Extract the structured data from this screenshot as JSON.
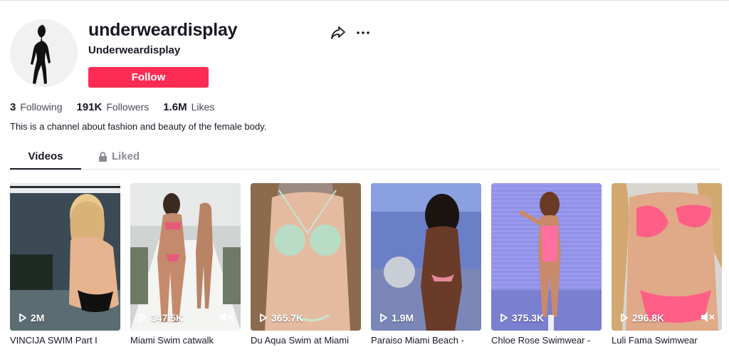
{
  "profile": {
    "username": "underweardisplay",
    "nickname": "Underweardisplay",
    "follow_label": "Follow",
    "bio": "This is a channel about fashion and beauty of the female body."
  },
  "stats": {
    "following_count": "3",
    "following_label": "Following",
    "followers_count": "191K",
    "followers_label": "Followers",
    "likes_count": "1.6M",
    "likes_label": "Likes"
  },
  "tabs": {
    "videos": "Videos",
    "liked": "Liked"
  },
  "icons": {
    "share": "share-icon",
    "more": "more-icon",
    "lock": "lock-icon",
    "play": "play-icon",
    "mute": "mute-icon"
  },
  "colors": {
    "accent": "#fe2c55",
    "text": "#161823",
    "muted": "#8a8b91"
  },
  "videos": [
    {
      "views": "2M",
      "caption": "VINCIJA SWIM Part I",
      "muted": false
    },
    {
      "views": "347.5K",
      "caption": "Miami Swim catwalk",
      "muted": true
    },
    {
      "views": "365.7K",
      "caption": "Du Aqua Swim at Miami",
      "muted": false
    },
    {
      "views": "1.9M",
      "caption": "Paraiso Miami Beach -",
      "muted": false
    },
    {
      "views": "375.3K",
      "caption": "Chloe Rose Swimwear -",
      "muted": false
    },
    {
      "views": "296.8K",
      "caption": "Luli Fama Swimwear",
      "muted": true
    }
  ]
}
